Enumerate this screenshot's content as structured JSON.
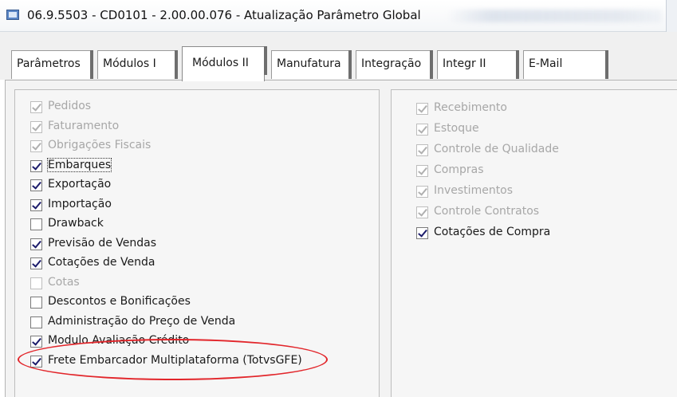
{
  "window": {
    "title": "06.9.5503 - CD0101 - 2.00.00.076 - Atualização Parâmetro Global"
  },
  "tabs": [
    {
      "label": "Parâmetros"
    },
    {
      "label": "Módulos I"
    },
    {
      "label": "Módulos II"
    },
    {
      "label": "Manufatura"
    },
    {
      "label": "Integração"
    },
    {
      "label": "Integr II"
    },
    {
      "label": "E-Mail"
    }
  ],
  "active_tab": "Módulos II",
  "left_group": {
    "items": [
      {
        "label": "Pedidos",
        "checked": true,
        "disabled": true
      },
      {
        "label": "Faturamento",
        "checked": true,
        "disabled": true
      },
      {
        "label": "Obrigações Fiscais",
        "checked": true,
        "disabled": true
      },
      {
        "label": "Embarques",
        "checked": true,
        "disabled": false
      },
      {
        "label": "Exportação",
        "checked": true,
        "disabled": false
      },
      {
        "label": "Importação",
        "checked": true,
        "disabled": false
      },
      {
        "label": "Drawback",
        "checked": false,
        "disabled": false
      },
      {
        "label": "Previsão de Vendas",
        "checked": true,
        "disabled": false
      },
      {
        "label": "Cotações de Venda",
        "checked": true,
        "disabled": false
      },
      {
        "label": "Cotas",
        "checked": false,
        "disabled": true
      },
      {
        "label": "Descontos e Bonificações",
        "checked": false,
        "disabled": false
      },
      {
        "label": "Administração do Preço de Venda",
        "checked": false,
        "disabled": false
      },
      {
        "label": "Modulo Avaliação Crédito",
        "checked": true,
        "disabled": false
      },
      {
        "label": "Frete Embarcador Multiplataforma (TotvsGFE)",
        "checked": true,
        "disabled": false
      }
    ]
  },
  "right_group": {
    "items": [
      {
        "label": "Recebimento",
        "checked": true,
        "disabled": true
      },
      {
        "label": "Estoque",
        "checked": true,
        "disabled": true
      },
      {
        "label": "Controle de Qualidade",
        "checked": true,
        "disabled": true
      },
      {
        "label": "Compras",
        "checked": true,
        "disabled": true
      },
      {
        "label": "Investimentos",
        "checked": true,
        "disabled": true
      },
      {
        "label": "Controle Contratos",
        "checked": true,
        "disabled": true
      },
      {
        "label": "Cotações de Compra",
        "checked": true,
        "disabled": false
      }
    ]
  },
  "colors": {
    "annotation": "#e2262b",
    "checkmark": "#1c1c6b",
    "disabled_text": "#a7a7a7"
  }
}
